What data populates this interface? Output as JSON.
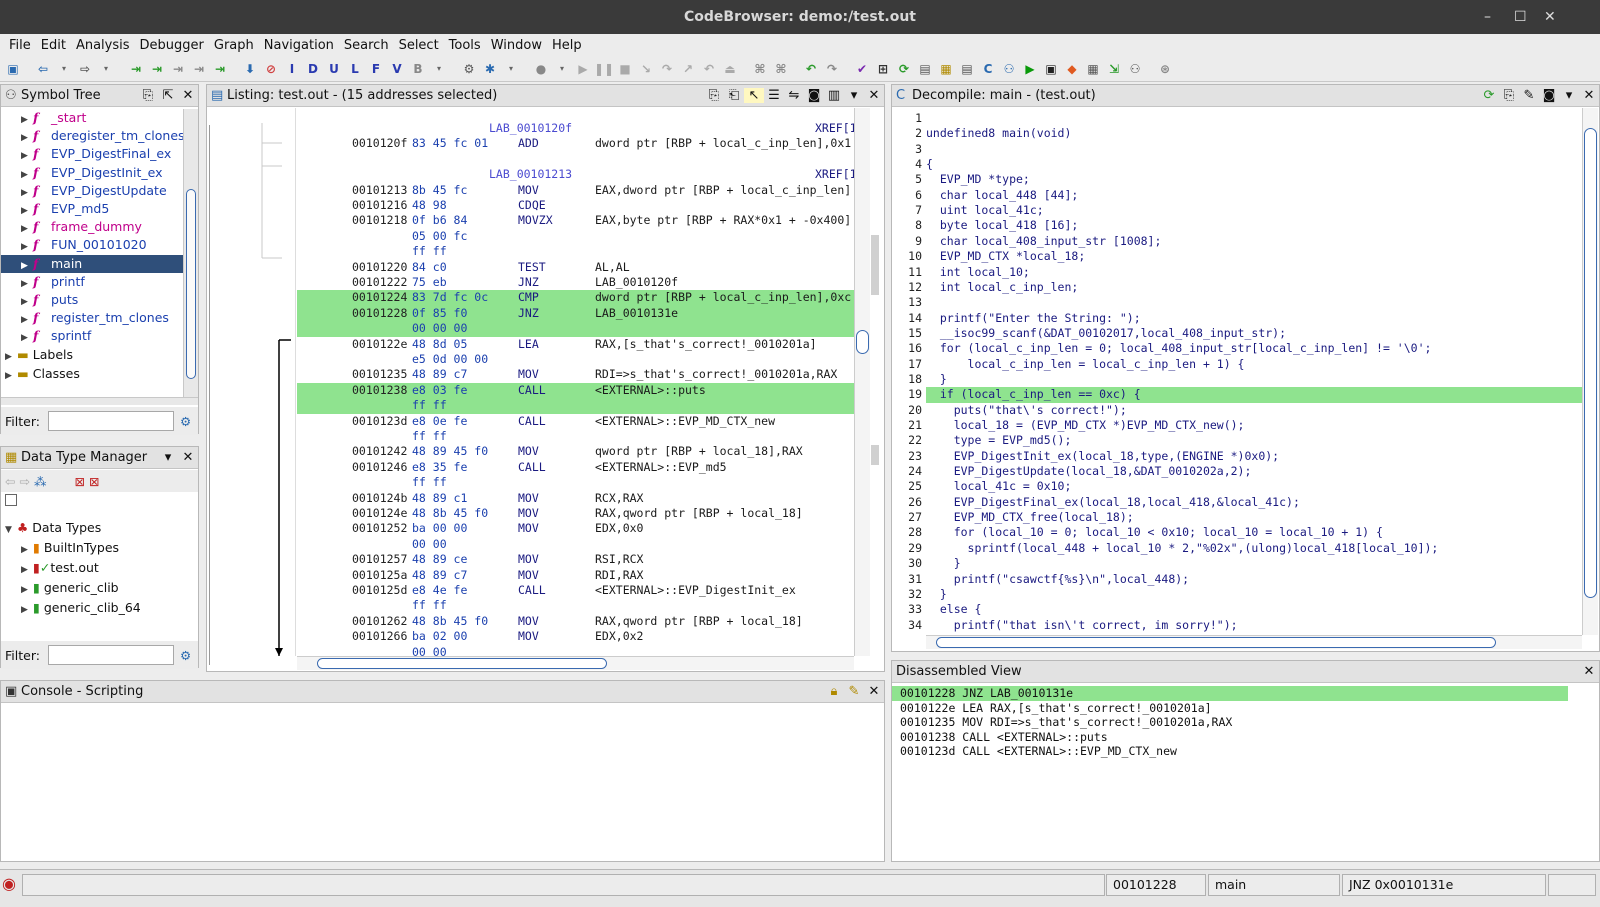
{
  "window": {
    "title": "CodeBrowser: demo:/test.out",
    "controls": [
      "–",
      "☐",
      "✕"
    ]
  },
  "menu": [
    "File",
    "Edit",
    "Analysis",
    "Debugger",
    "Graph",
    "Navigation",
    "Search",
    "Select",
    "Tools",
    "Window",
    "Help"
  ],
  "symbol_tree": {
    "title": "Symbol Tree",
    "items": [
      {
        "label": "_start",
        "color": "#c0008a"
      },
      {
        "label": "deregister_tm_clones",
        "color": "#1a3fae"
      },
      {
        "label": "EVP_DigestFinal_ex",
        "color": "#1a3fae"
      },
      {
        "label": "EVP_DigestInit_ex",
        "color": "#1a3fae"
      },
      {
        "label": "EVP_DigestUpdate",
        "color": "#1a3fae"
      },
      {
        "label": "EVP_md5",
        "color": "#1a3fae"
      },
      {
        "label": "frame_dummy",
        "color": "#c0008a"
      },
      {
        "label": "FUN_00101020",
        "color": "#1a3fae"
      },
      {
        "label": "main",
        "color": "#ffffff"
      },
      {
        "label": "printf",
        "color": "#1a3fae"
      },
      {
        "label": "puts",
        "color": "#1a3fae"
      },
      {
        "label": "register_tm_clones",
        "color": "#1a3fae"
      },
      {
        "label": "sprintf",
        "color": "#1a3fae"
      }
    ],
    "folders": [
      "Labels",
      "Classes"
    ],
    "filter_label": "Filter:"
  },
  "data_type_manager": {
    "title": "Data Type Manager",
    "root": "Data Types",
    "items": [
      "BuiltInTypes",
      "test.out",
      "generic_clib",
      "generic_clib_64"
    ],
    "filter_label": "Filter:"
  },
  "listing": {
    "title": "Listing:  test.out - (15 addresses selected)",
    "rows": [
      {
        "addr": "",
        "bytes": "",
        "mn": "LAB_0010120f",
        "op": "",
        "xref": "XREF[1",
        "hl": false,
        "label": true
      },
      {
        "addr": "0010120f",
        "bytes": "83 45 fc 01",
        "mn": "ADD",
        "op": "dword ptr [RBP + local_c_inp_len],0x1",
        "xref": "",
        "hl": false,
        "label": false
      },
      {
        "addr": "",
        "bytes": "",
        "mn": "",
        "op": "",
        "xref": "",
        "hl": false,
        "label": false
      },
      {
        "addr": "",
        "bytes": "",
        "mn": "LAB_00101213",
        "op": "",
        "xref": "XREF[1",
        "hl": false,
        "label": true
      },
      {
        "addr": "00101213",
        "bytes": "8b 45 fc",
        "mn": "MOV",
        "op": "EAX,dword ptr [RBP + local_c_inp_len]",
        "xref": "",
        "hl": false,
        "label": false
      },
      {
        "addr": "00101216",
        "bytes": "48 98",
        "mn": "CDQE",
        "op": "",
        "xref": "",
        "hl": false,
        "label": false
      },
      {
        "addr": "00101218",
        "bytes": "0f b6 84",
        "mn": "MOVZX",
        "op": "EAX,byte ptr [RBP + RAX*0x1 + -0x400]",
        "xref": "",
        "hl": false,
        "label": false
      },
      {
        "addr": "",
        "bytes": "05 00 fc",
        "mn": "",
        "op": "",
        "xref": "",
        "hl": false,
        "label": false
      },
      {
        "addr": "",
        "bytes": "ff ff",
        "mn": "",
        "op": "",
        "xref": "",
        "hl": false,
        "label": false
      },
      {
        "addr": "00101220",
        "bytes": "84 c0",
        "mn": "TEST",
        "op": "AL,AL",
        "xref": "",
        "hl": false,
        "label": false
      },
      {
        "addr": "00101222",
        "bytes": "75 eb",
        "mn": "JNZ",
        "op": "LAB_0010120f",
        "xref": "",
        "hl": false,
        "label": false
      },
      {
        "addr": "00101224",
        "bytes": "83 7d fc 0c",
        "mn": "CMP",
        "op": "dword ptr [RBP + local_c_inp_len],0xc",
        "xref": "",
        "hl": true,
        "label": false
      },
      {
        "addr": "00101228",
        "bytes": "0f 85 f0",
        "mn": "JNZ",
        "op": "LAB_0010131e",
        "xref": "",
        "hl": true,
        "label": false
      },
      {
        "addr": "",
        "bytes": "00 00 00",
        "mn": "",
        "op": "",
        "xref": "",
        "hl": true,
        "label": false
      },
      {
        "addr": "0010122e",
        "bytes": "48 8d 05",
        "mn": "LEA",
        "op": "RAX,[s_that's_correct!_0010201a]",
        "xref": "",
        "hl": false,
        "label": false
      },
      {
        "addr": "",
        "bytes": "e5 0d 00 00",
        "mn": "",
        "op": "",
        "xref": "",
        "hl": false,
        "label": false
      },
      {
        "addr": "00101235",
        "bytes": "48 89 c7",
        "mn": "MOV",
        "op": "RDI=>s_that's_correct!_0010201a,RAX",
        "xref": "",
        "hl": false,
        "label": false
      },
      {
        "addr": "00101238",
        "bytes": "e8 03 fe",
        "mn": "CALL",
        "op": "<EXTERNAL>::puts",
        "xref": "",
        "hl": true,
        "label": false
      },
      {
        "addr": "",
        "bytes": "ff ff",
        "mn": "",
        "op": "",
        "xref": "",
        "hl": true,
        "label": false
      },
      {
        "addr": "0010123d",
        "bytes": "e8 0e fe",
        "mn": "CALL",
        "op": "<EXTERNAL>::EVP_MD_CTX_new",
        "xref": "",
        "hl": false,
        "label": false
      },
      {
        "addr": "",
        "bytes": "ff ff",
        "mn": "",
        "op": "",
        "xref": "",
        "hl": false,
        "label": false
      },
      {
        "addr": "00101242",
        "bytes": "48 89 45 f0",
        "mn": "MOV",
        "op": "qword ptr [RBP + local_18],RAX",
        "xref": "",
        "hl": false,
        "label": false
      },
      {
        "addr": "00101246",
        "bytes": "e8 35 fe",
        "mn": "CALL",
        "op": "<EXTERNAL>::EVP_md5",
        "xref": "",
        "hl": false,
        "label": false
      },
      {
        "addr": "",
        "bytes": "ff ff",
        "mn": "",
        "op": "",
        "xref": "",
        "hl": false,
        "label": false
      },
      {
        "addr": "0010124b",
        "bytes": "48 89 c1",
        "mn": "MOV",
        "op": "RCX,RAX",
        "xref": "",
        "hl": false,
        "label": false
      },
      {
        "addr": "0010124e",
        "bytes": "48 8b 45 f0",
        "mn": "MOV",
        "op": "RAX,qword ptr [RBP + local_18]",
        "xref": "",
        "hl": false,
        "label": false
      },
      {
        "addr": "00101252",
        "bytes": "ba 00 00",
        "mn": "MOV",
        "op": "EDX,0x0",
        "xref": "",
        "hl": false,
        "label": false
      },
      {
        "addr": "",
        "bytes": "00 00",
        "mn": "",
        "op": "",
        "xref": "",
        "hl": false,
        "label": false
      },
      {
        "addr": "00101257",
        "bytes": "48 89 ce",
        "mn": "MOV",
        "op": "RSI,RCX",
        "xref": "",
        "hl": false,
        "label": false
      },
      {
        "addr": "0010125a",
        "bytes": "48 89 c7",
        "mn": "MOV",
        "op": "RDI,RAX",
        "xref": "",
        "hl": false,
        "label": false
      },
      {
        "addr": "0010125d",
        "bytes": "e8 4e fe",
        "mn": "CALL",
        "op": "<EXTERNAL>::EVP_DigestInit_ex",
        "xref": "",
        "hl": false,
        "label": false
      },
      {
        "addr": "",
        "bytes": "ff ff",
        "mn": "",
        "op": "",
        "xref": "",
        "hl": false,
        "label": false
      },
      {
        "addr": "00101262",
        "bytes": "48 8b 45 f0",
        "mn": "MOV",
        "op": "RAX,qword ptr [RBP + local_18]",
        "xref": "",
        "hl": false,
        "label": false
      },
      {
        "addr": "00101266",
        "bytes": "ba 02 00",
        "mn": "MOV",
        "op": "EDX,0x2",
        "xref": "",
        "hl": false,
        "label": false
      },
      {
        "addr": "",
        "bytes": "00 00",
        "mn": "",
        "op": "",
        "xref": "",
        "hl": false,
        "label": false
      }
    ]
  },
  "decompile": {
    "title": "Decompile: main - (test.out)",
    "lines": [
      {
        "n": "1",
        "t": "",
        "hl": false
      },
      {
        "n": "2",
        "t": "undefined8 main(void)",
        "hl": false
      },
      {
        "n": "3",
        "t": "",
        "hl": false
      },
      {
        "n": "4",
        "t": "{",
        "hl": false
      },
      {
        "n": "5",
        "t": "  EVP_MD *type;",
        "hl": false
      },
      {
        "n": "6",
        "t": "  char local_448 [44];",
        "hl": false
      },
      {
        "n": "7",
        "t": "  uint local_41c;",
        "hl": false
      },
      {
        "n": "8",
        "t": "  byte local_418 [16];",
        "hl": false
      },
      {
        "n": "9",
        "t": "  char local_408_input_str [1008];",
        "hl": false
      },
      {
        "n": "10",
        "t": "  EVP_MD_CTX *local_18;",
        "hl": false
      },
      {
        "n": "11",
        "t": "  int local_10;",
        "hl": false
      },
      {
        "n": "12",
        "t": "  int local_c_inp_len;",
        "hl": false
      },
      {
        "n": "13",
        "t": "",
        "hl": false
      },
      {
        "n": "14",
        "t": "  printf(\"Enter the String: \");",
        "hl": false
      },
      {
        "n": "15",
        "t": "  __isoc99_scanf(&DAT_00102017,local_408_input_str);",
        "hl": false
      },
      {
        "n": "16",
        "t": "  for (local_c_inp_len = 0; local_408_input_str[local_c_inp_len] != '\\0';",
        "hl": false
      },
      {
        "n": "17",
        "t": "      local_c_inp_len = local_c_inp_len + 1) {",
        "hl": false
      },
      {
        "n": "18",
        "t": "  }",
        "hl": false
      },
      {
        "n": "19",
        "t": "  if (local_c_inp_len == 0xc) {",
        "hl": true
      },
      {
        "n": "20",
        "t": "    puts(\"that\\'s correct!\");",
        "hl": false
      },
      {
        "n": "21",
        "t": "    local_18 = (EVP_MD_CTX *)EVP_MD_CTX_new();",
        "hl": false
      },
      {
        "n": "22",
        "t": "    type = EVP_md5();",
        "hl": false
      },
      {
        "n": "23",
        "t": "    EVP_DigestInit_ex(local_18,type,(ENGINE *)0x0);",
        "hl": false
      },
      {
        "n": "24",
        "t": "    EVP_DigestUpdate(local_18,&DAT_0010202a,2);",
        "hl": false
      },
      {
        "n": "25",
        "t": "    local_41c = 0x10;",
        "hl": false
      },
      {
        "n": "26",
        "t": "    EVP_DigestFinal_ex(local_18,local_418,&local_41c);",
        "hl": false
      },
      {
        "n": "27",
        "t": "    EVP_MD_CTX_free(local_18);",
        "hl": false
      },
      {
        "n": "28",
        "t": "    for (local_10 = 0; local_10 < 0x10; local_10 = local_10 + 1) {",
        "hl": false
      },
      {
        "n": "29",
        "t": "      sprintf(local_448 + local_10 * 2,\"%02x\",(ulong)local_418[local_10]);",
        "hl": false
      },
      {
        "n": "30",
        "t": "    }",
        "hl": false
      },
      {
        "n": "31",
        "t": "    printf(\"csawctf{%s}\\n\",local_448);",
        "hl": false
      },
      {
        "n": "32",
        "t": "  }",
        "hl": false
      },
      {
        "n": "33",
        "t": "  else {",
        "hl": false
      },
      {
        "n": "34",
        "t": "    printf(\"that isn\\'t correct, im sorry!\");",
        "hl": false
      }
    ]
  },
  "disassembled_view": {
    "title": "Disassembled View",
    "lines": [
      {
        "t": "00101228 JNZ LAB_0010131e",
        "hl": true
      },
      {
        "t": "0010122e LEA RAX,[s_that's_correct!_0010201a]",
        "hl": false
      },
      {
        "t": "00101235 MOV RDI=>s_that's_correct!_0010201a,RAX",
        "hl": false
      },
      {
        "t": "00101238 CALL <EXTERNAL>::puts",
        "hl": false
      },
      {
        "t": "0010123d CALL <EXTERNAL>::EVP_MD_CTX_new",
        "hl": false
      }
    ]
  },
  "console": {
    "title": "Console - Scripting"
  },
  "status": {
    "address": "00101228",
    "function": "main",
    "instruction": "JNZ 0x0010131e"
  },
  "colors": {
    "highlight": "#8fe38f",
    "selection": "#2f4f7a",
    "title_bar": "#3a3a3a"
  }
}
